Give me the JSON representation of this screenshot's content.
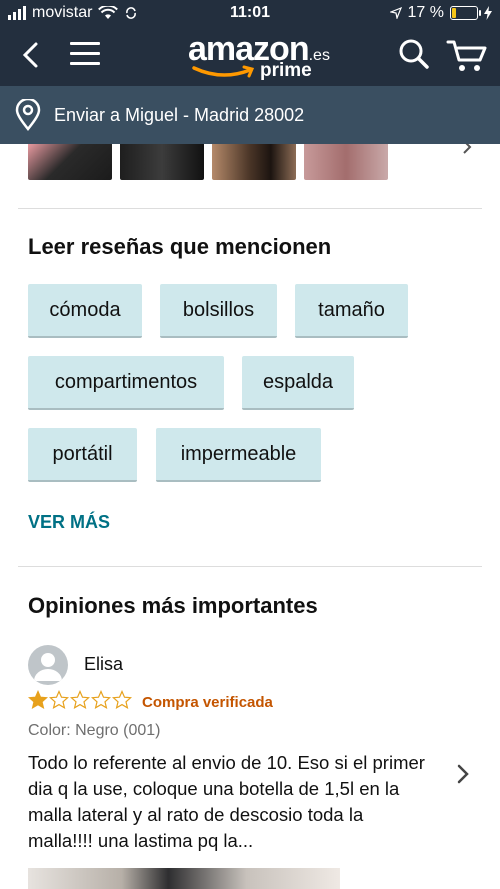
{
  "status_bar": {
    "carrier": "movistar",
    "time": "11:01",
    "battery_percent": "17 %",
    "battery_level": 0.17
  },
  "header": {
    "logo_word": "amazon",
    "logo_tld": ".es",
    "logo_sub": "prime"
  },
  "location": {
    "text": "Enviar a Miguel - Madrid 28002"
  },
  "mentions": {
    "title": "Leer reseñas que mencionen",
    "chips": [
      "cómoda",
      "bolsillos",
      "tamaño",
      "compartimentos",
      "espalda",
      "portátil",
      "impermeable"
    ],
    "see_more": "VER MÁS"
  },
  "top_reviews": {
    "title": "Opiniones más importantes",
    "review": {
      "reviewer": "Elisa",
      "rating": 1,
      "rating_max": 5,
      "verified": "Compra verificada",
      "variant": "Color: Negro (001)",
      "text": "Todo lo referente al envio de 10. Eso si el primer dia q la use, coloque una botella de 1,5l en la malla lateral y al rato de descosio toda la malla!!!! una lastima pq la..."
    }
  },
  "colors": {
    "header_bg": "#232f3e",
    "location_bg": "#3a4f61",
    "chip_bg": "#cfe8ec",
    "link": "#007185",
    "verified": "#c45500",
    "star": "#e7a11c"
  },
  "icons": [
    "back-icon",
    "menu-icon",
    "search-icon",
    "cart-icon",
    "location-pin-icon",
    "chevron-right-icon",
    "wifi-icon",
    "star-icon"
  ]
}
